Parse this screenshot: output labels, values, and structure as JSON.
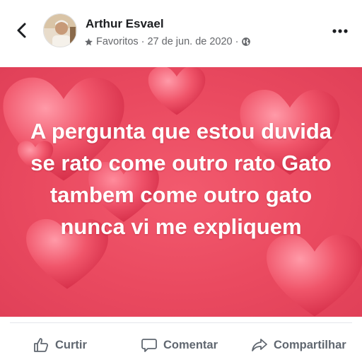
{
  "post": {
    "author": "Arthur Esvael",
    "audience": "Favoritos",
    "separator": "·",
    "date": "27 de jun. de 2020",
    "text": "A pergunta que estou duvida se rato come outro rato Gato tambem come outro gato nunca vi me expliquem",
    "background_color": "#ea4a60"
  },
  "icons": {
    "back": "chevron-left-icon",
    "audience": "star-icon",
    "privacy": "globe-icon",
    "more": "more-dots-icon",
    "like": "thumbs-up-icon",
    "comment": "comment-bubble-icon",
    "share": "share-arrow-icon"
  },
  "actions": {
    "like_label": "Curtir",
    "comment_label": "Comentar",
    "share_label": "Compartilhar"
  }
}
